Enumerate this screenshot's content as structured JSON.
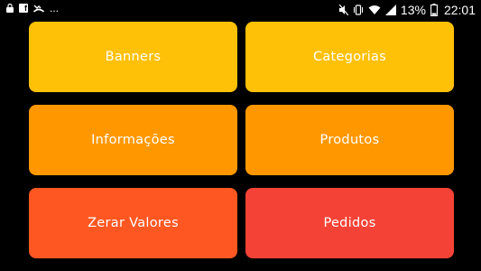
{
  "status_bar": {
    "left_icons": [
      "lock-icon",
      "facebook-icon",
      "missed-call-icon",
      "more-notifications-icon"
    ],
    "more_indicator": "...",
    "right_icons": [
      "mute-icon",
      "vibrate-icon",
      "wifi-icon",
      "signal-icon",
      "battery-icon"
    ],
    "battery_percent": "13%",
    "time": "22:01",
    "text_color": "#ffffff"
  },
  "menu": {
    "tiles": [
      {
        "label": "Banners",
        "color": "#ffc107"
      },
      {
        "label": "Categorias",
        "color": "#ffc107"
      },
      {
        "label": "Informações",
        "color": "#ff9800"
      },
      {
        "label": "Produtos",
        "color": "#ff9800"
      },
      {
        "label": "Zerar Valores",
        "color": "#ff5722"
      },
      {
        "label": "Pedidos",
        "color": "#f44336"
      }
    ]
  },
  "background_color": "#000000"
}
